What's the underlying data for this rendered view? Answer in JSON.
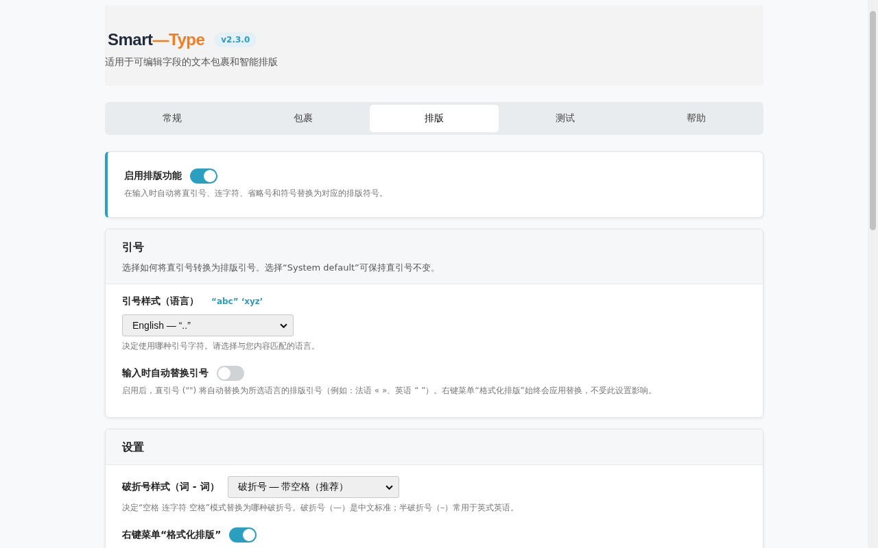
{
  "header": {
    "title_left": "Smart",
    "title_dash": "—",
    "title_right": "Type",
    "version": "v2.3.0",
    "subtitle": "适用于可编辑字段的文本包裹和智能排版"
  },
  "tabs": [
    {
      "label": "常规",
      "selected": false
    },
    {
      "label": "包裹",
      "selected": false
    },
    {
      "label": "排版",
      "selected": true
    },
    {
      "label": "测试",
      "selected": false
    },
    {
      "label": "帮助",
      "selected": false
    }
  ],
  "master": {
    "label": "启用排版功能",
    "on": true,
    "description": "在输入时自动将直引号、连字符、省略号和符号替换为对应的排版符号。"
  },
  "sections": [
    {
      "title": "引号",
      "description": "选择如何将直引号转换为排版引号。选择“System default”可保持直引号不变。",
      "rows": [
        {
          "kind": "select",
          "label": "引号样式（语言）",
          "preview": "“abc” ‘xyz’",
          "value": "English — “..”",
          "help": "决定使用哪种引号字符。请选择与您内容匹配的语言。"
        },
        {
          "kind": "toggle",
          "label": "输入时自动替换引号",
          "on": false,
          "help": "启用后，直引号 (\"\") 将自动替换为所选语言的排版引号（例如：法语 « »、英语 “ ”）。右键菜单“格式化排版”始终会应用替换，不受此设置影响。"
        }
      ]
    },
    {
      "title": "设置",
      "rows": [
        {
          "kind": "inline-select",
          "label": "破折号样式（词 - 词）",
          "value": "破折号 — 带空格（推荐）",
          "help": "决定“空格 连字符 空格”模式替换为哪种破折号。破折号（—）是中文标准；半破折号（–）常用于英式英语。"
        },
        {
          "kind": "toggle",
          "label": "右键菜单“格式化排版”",
          "on": true
        }
      ]
    }
  ]
}
